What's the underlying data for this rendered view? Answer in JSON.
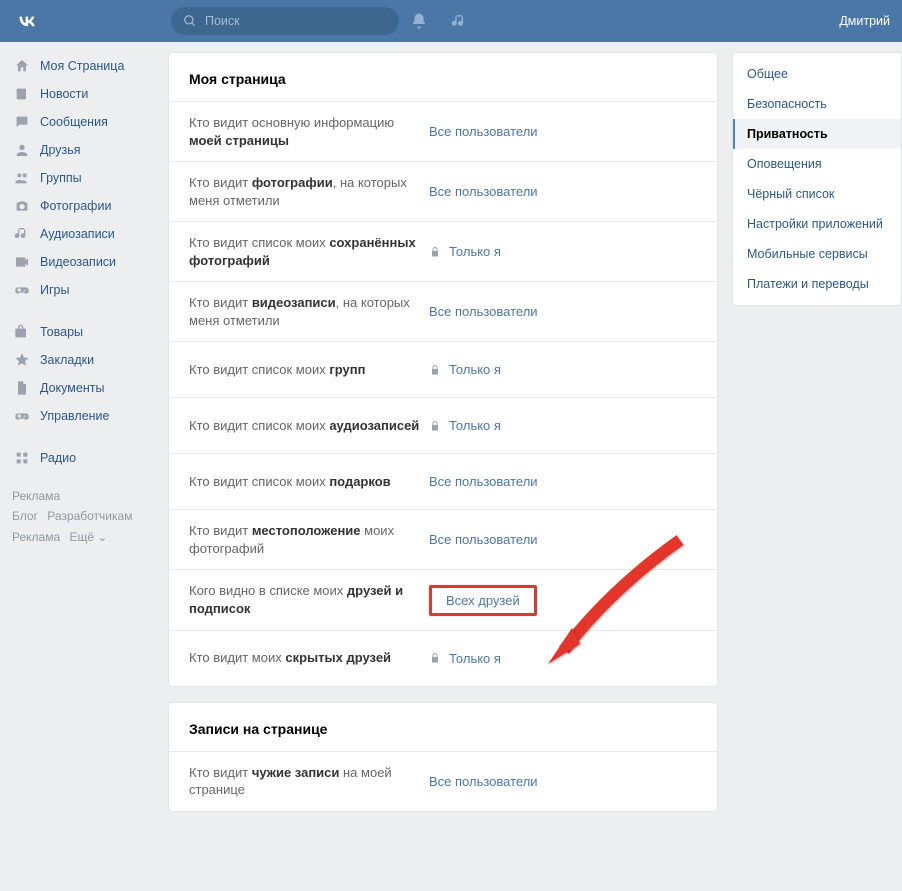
{
  "header": {
    "search_placeholder": "Поиск",
    "username": "Дмитрий"
  },
  "sidebar": {
    "items": [
      {
        "icon": "home",
        "label": "Моя Страница"
      },
      {
        "icon": "newspaper",
        "label": "Новости"
      },
      {
        "icon": "chat",
        "label": "Сообщения"
      },
      {
        "icon": "user",
        "label": "Друзья"
      },
      {
        "icon": "users",
        "label": "Группы"
      },
      {
        "icon": "camera",
        "label": "Фотографии"
      },
      {
        "icon": "music",
        "label": "Аудиозаписи"
      },
      {
        "icon": "video",
        "label": "Видеозаписи"
      },
      {
        "icon": "gamepad",
        "label": "Игры"
      }
    ],
    "items2": [
      {
        "icon": "bag",
        "label": "Товары"
      },
      {
        "icon": "star",
        "label": "Закладки"
      },
      {
        "icon": "file",
        "label": "Документы"
      },
      {
        "icon": "gamepad",
        "label": "Управление"
      }
    ],
    "items3": [
      {
        "icon": "grid",
        "label": "Радио"
      }
    ],
    "footer": {
      "ad": "Реклама",
      "blog": "Блог",
      "dev": "Разработчикам",
      "ad2": "Реклама",
      "more": "Ещё ⌄"
    }
  },
  "panels": [
    {
      "title": "Моя страница",
      "rows": [
        {
          "label_pre": "Кто видит основную информацию ",
          "label_bold": "моей страницы",
          "value": "Все пользователи",
          "locked": false
        },
        {
          "label_pre": "Кто видит ",
          "label_bold": "фотографии",
          "label_post": ", на которых меня отметили",
          "value": "Все пользователи",
          "locked": false
        },
        {
          "label_pre": "Кто видит список моих ",
          "label_bold": "сохранённых фотографий",
          "value": "Только я",
          "locked": true
        },
        {
          "label_pre": "Кто видит ",
          "label_bold": "видеозаписи",
          "label_post": ", на которых меня отметили",
          "value": "Все пользователи",
          "locked": false
        },
        {
          "label_pre": "Кто видит список моих ",
          "label_bold": "групп",
          "value": "Только я",
          "locked": true
        },
        {
          "label_pre": "Кто видит список моих ",
          "label_bold": "аудиозаписей",
          "value": "Только я",
          "locked": true
        },
        {
          "label_pre": "Кто видит список моих ",
          "label_bold": "подарков",
          "value": "Все пользователи",
          "locked": false
        },
        {
          "label_pre": "Кто видит ",
          "label_bold": "местоположение",
          "label_post": " моих фотографий",
          "value": "Все пользователи",
          "locked": false
        },
        {
          "label_pre": "Кого видно в списке моих ",
          "label_bold": "друзей и подписок",
          "value": "Всех друзей",
          "locked": false,
          "highlight": true
        },
        {
          "label_pre": "Кто видит моих ",
          "label_bold": "скрытых друзей",
          "value": "Только я",
          "locked": true
        }
      ]
    },
    {
      "title": "Записи на странице",
      "rows": [
        {
          "label_pre": "Кто видит ",
          "label_bold": "чужие записи",
          "label_post": " на моей странице",
          "value": "Все пользователи",
          "locked": false
        }
      ]
    }
  ],
  "settings_nav": {
    "items": [
      {
        "label": "Общее"
      },
      {
        "label": "Безопасность"
      },
      {
        "label": "Приватность",
        "active": true
      },
      {
        "label": "Оповещения"
      },
      {
        "label": "Чёрный список"
      },
      {
        "label": "Настройки приложений"
      },
      {
        "label": "Мобильные сервисы"
      },
      {
        "label": "Платежи и переводы"
      }
    ]
  }
}
